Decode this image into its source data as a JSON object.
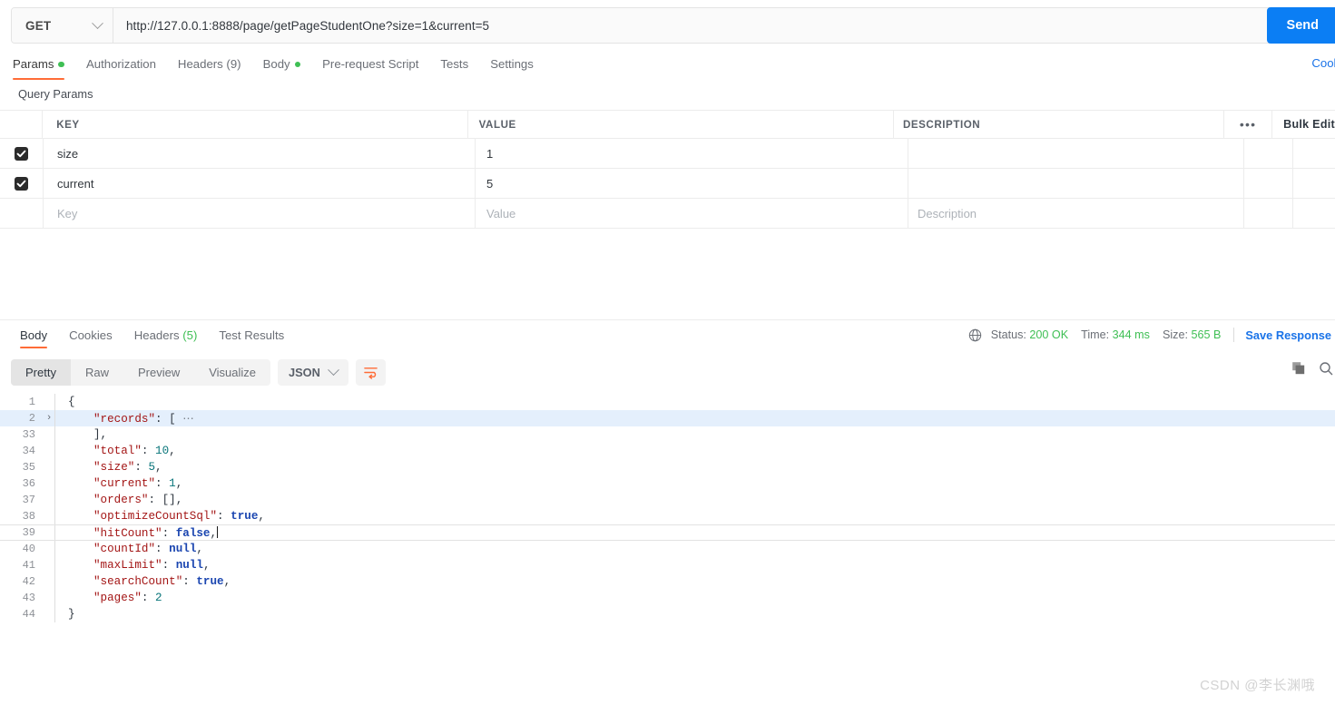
{
  "request": {
    "method": "GET",
    "url": "http://127.0.0.1:8888/page/getPageStudentOne?size=1&current=5",
    "send_label": "Send",
    "cookies_link": "Cookies",
    "tabs": [
      {
        "label": "Params",
        "dot": true,
        "active": true
      },
      {
        "label": "Authorization",
        "dot": false,
        "active": false
      },
      {
        "label": "Headers (9)",
        "dot": false,
        "active": false
      },
      {
        "label": "Body",
        "dot": true,
        "active": false
      },
      {
        "label": "Pre-request Script",
        "dot": false,
        "active": false
      },
      {
        "label": "Tests",
        "dot": false,
        "active": false
      },
      {
        "label": "Settings",
        "dot": false,
        "active": false
      }
    ]
  },
  "params": {
    "section_title": "Query Params",
    "columns": {
      "key": "KEY",
      "value": "VALUE",
      "description": "DESCRIPTION"
    },
    "bulk_edit": "Bulk Edit",
    "rows": [
      {
        "checked": true,
        "key": "size",
        "value": "1",
        "description": ""
      },
      {
        "checked": true,
        "key": "current",
        "value": "5",
        "description": ""
      }
    ],
    "placeholder_row": {
      "key": "Key",
      "value": "Value",
      "description": "Description"
    }
  },
  "response": {
    "tabs": [
      {
        "label": "Body",
        "active": true
      },
      {
        "label": "Cookies",
        "active": false
      },
      {
        "label": "Headers",
        "count": "(5)",
        "active": false
      },
      {
        "label": "Test Results",
        "active": false
      }
    ],
    "status": {
      "status_label": "Status:",
      "status_value": "200 OK",
      "time_label": "Time:",
      "time_value": "344 ms",
      "size_label": "Size:",
      "size_value": "565 B",
      "save_response": "Save Response"
    },
    "format_tabs": [
      {
        "label": "Pretty",
        "active": true
      },
      {
        "label": "Raw",
        "active": false
      },
      {
        "label": "Preview",
        "active": false
      },
      {
        "label": "Visualize",
        "active": false
      }
    ],
    "language": "JSON",
    "code_lines": [
      {
        "num": "1",
        "fold": "",
        "indent": 0,
        "tokens": [
          {
            "t": "{",
            "c": "p"
          }
        ]
      },
      {
        "num": "2",
        "fold": "›",
        "highlight": true,
        "indent": 1,
        "tokens": [
          {
            "t": "\"records\"",
            "c": "k"
          },
          {
            "t": ": [",
            "c": "p"
          },
          {
            "t": " ⋯",
            "c": "fd"
          }
        ]
      },
      {
        "num": "33",
        "fold": "",
        "indent": 1,
        "tokens": [
          {
            "t": "],",
            "c": "p"
          }
        ]
      },
      {
        "num": "34",
        "fold": "",
        "indent": 1,
        "tokens": [
          {
            "t": "\"total\"",
            "c": "k"
          },
          {
            "t": ": ",
            "c": "p"
          },
          {
            "t": "10",
            "c": "n"
          },
          {
            "t": ",",
            "c": "p"
          }
        ]
      },
      {
        "num": "35",
        "fold": "",
        "indent": 1,
        "tokens": [
          {
            "t": "\"size\"",
            "c": "k"
          },
          {
            "t": ": ",
            "c": "p"
          },
          {
            "t": "5",
            "c": "n"
          },
          {
            "t": ",",
            "c": "p"
          }
        ]
      },
      {
        "num": "36",
        "fold": "",
        "indent": 1,
        "tokens": [
          {
            "t": "\"current\"",
            "c": "k"
          },
          {
            "t": ": ",
            "c": "p"
          },
          {
            "t": "1",
            "c": "n"
          },
          {
            "t": ",",
            "c": "p"
          }
        ]
      },
      {
        "num": "37",
        "fold": "",
        "indent": 1,
        "tokens": [
          {
            "t": "\"orders\"",
            "c": "k"
          },
          {
            "t": ": [],",
            "c": "p"
          }
        ]
      },
      {
        "num": "38",
        "fold": "",
        "indent": 1,
        "tokens": [
          {
            "t": "\"optimizeCountSql\"",
            "c": "k"
          },
          {
            "t": ": ",
            "c": "p"
          },
          {
            "t": "true",
            "c": "b"
          },
          {
            "t": ",",
            "c": "p"
          }
        ]
      },
      {
        "num": "39",
        "fold": "",
        "cursor": true,
        "indent": 1,
        "tokens": [
          {
            "t": "\"hitCount\"",
            "c": "k"
          },
          {
            "t": ": ",
            "c": "p"
          },
          {
            "t": "false",
            "c": "b"
          },
          {
            "t": ",",
            "c": "p"
          },
          {
            "t": "|",
            "c": "caret"
          }
        ]
      },
      {
        "num": "40",
        "fold": "",
        "indent": 1,
        "tokens": [
          {
            "t": "\"countId\"",
            "c": "k"
          },
          {
            "t": ": ",
            "c": "p"
          },
          {
            "t": "null",
            "c": "b"
          },
          {
            "t": ",",
            "c": "p"
          }
        ]
      },
      {
        "num": "41",
        "fold": "",
        "indent": 1,
        "tokens": [
          {
            "t": "\"maxLimit\"",
            "c": "k"
          },
          {
            "t": ": ",
            "c": "p"
          },
          {
            "t": "null",
            "c": "b"
          },
          {
            "t": ",",
            "c": "p"
          }
        ]
      },
      {
        "num": "42",
        "fold": "",
        "indent": 1,
        "tokens": [
          {
            "t": "\"searchCount\"",
            "c": "k"
          },
          {
            "t": ": ",
            "c": "p"
          },
          {
            "t": "true",
            "c": "b"
          },
          {
            "t": ",",
            "c": "p"
          }
        ]
      },
      {
        "num": "43",
        "fold": "",
        "indent": 1,
        "tokens": [
          {
            "t": "\"pages\"",
            "c": "k"
          },
          {
            "t": ": ",
            "c": "p"
          },
          {
            "t": "2",
            "c": "n"
          }
        ]
      },
      {
        "num": "44",
        "fold": "",
        "indent": 0,
        "tokens": [
          {
            "t": "}",
            "c": "p"
          }
        ]
      }
    ]
  },
  "watermark": "CSDN @李长渊哦",
  "colors": {
    "accent_orange": "#ff6c37",
    "send_blue": "#0b7ef4",
    "link_blue": "#1a73e8",
    "status_green": "#3fbf54",
    "json_key": "#a31515",
    "json_number": "#09757a",
    "json_bool": "#1a45b0",
    "highlight_line": "#e4effc"
  }
}
